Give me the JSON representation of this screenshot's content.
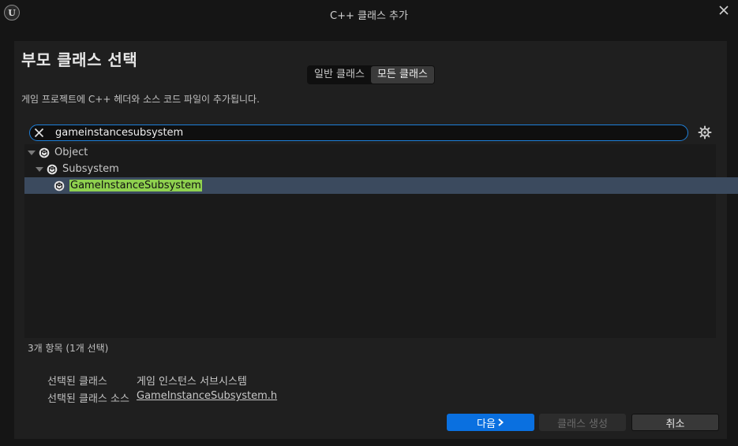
{
  "window": {
    "title": "C++ 클래스 추가",
    "logo_text": "U"
  },
  "header": {
    "title": "부모 클래스 선택"
  },
  "mode_toggle": {
    "common_label": "일반 클래스",
    "all_label": "모든 클래스",
    "active": "all"
  },
  "description": "게임 프로젝트에 C++ 헤더와 소스 코드 파일이 추가됩니다.",
  "search": {
    "value": "gameinstancesubsystem"
  },
  "tree": [
    {
      "label": "Object",
      "expanded": true,
      "selected": false
    },
    {
      "label": "Subsystem",
      "expanded": true,
      "selected": false
    },
    {
      "label": "GameInstanceSubsystem",
      "expanded": false,
      "selected": true
    }
  ],
  "status": {
    "count_text": "3개 항목 (1개 선택)"
  },
  "info": {
    "selected_class_label": "선택된 클래스",
    "selected_class_value": "게임 인스턴스 서브시스템",
    "selected_source_label": "선택된 클래스 소스",
    "selected_source_value": "GameInstanceSubsystem.h"
  },
  "buttons": {
    "next": "다음",
    "create": "클래스 생성",
    "cancel": "취소"
  },
  "colors": {
    "accent": "#0a70e0",
    "search_border": "#1e7fd8",
    "selection_bg": "#3b4a5e",
    "highlight": "#8fd14f"
  }
}
